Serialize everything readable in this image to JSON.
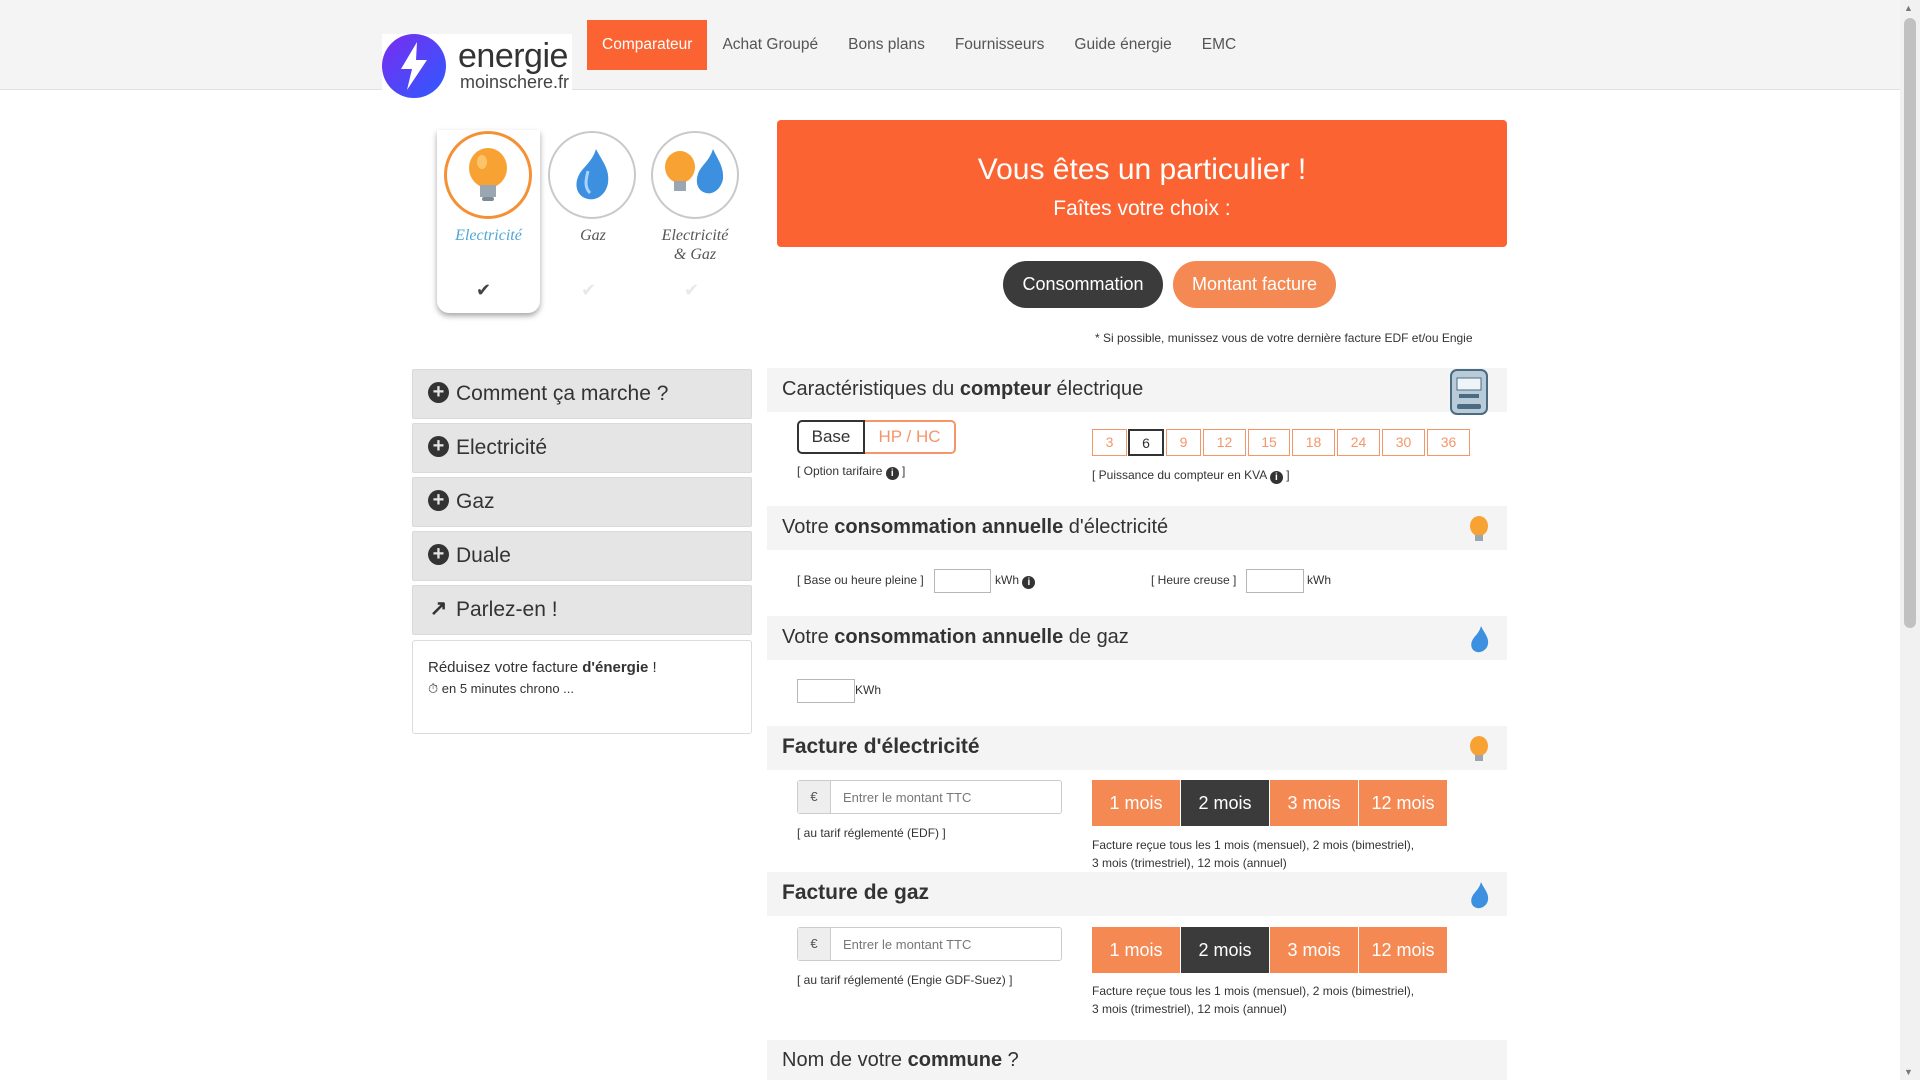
{
  "header": {
    "logo_main": "energie",
    "logo_sub": "moinschere.fr",
    "nav": [
      "Comparateur",
      "Achat Groupé",
      "Bons plans",
      "Fournisseurs",
      "Guide énergie",
      "EMC"
    ]
  },
  "energy_types": [
    {
      "label": "Electricité",
      "selected": true
    },
    {
      "label": "Gaz",
      "selected": false
    },
    {
      "label": "Electricité & Gaz",
      "selected": false
    }
  ],
  "banner": {
    "title": "Vous êtes un particulier !",
    "subtitle": "Faîtes votre choix :"
  },
  "choice": {
    "consommation": "Consommation",
    "montant": "Montant facture"
  },
  "note": "* Si possible, munissez vous de votre dernière facture EDF et/ou Engie",
  "accordion": [
    {
      "label": "Comment ça marche ?"
    },
    {
      "label": "Electricité"
    },
    {
      "label": "Gaz"
    },
    {
      "label": "Duale"
    },
    {
      "label": "Parlez-en !"
    }
  ],
  "promo": {
    "line1_a": "Réduisez votre facture ",
    "line1_b": "d'énergie",
    "line1_c": " !",
    "line2": "en 5 minutes chrono ..."
  },
  "compteur": {
    "title_a": "Caractéristiques du ",
    "title_b": "compteur",
    "title_c": " électrique",
    "option_base": "Base",
    "option_hphc": "HP / HC",
    "option_label": "[ Option tarifaire",
    "kva_values": [
      "3",
      "6",
      "9",
      "12",
      "15",
      "18",
      "24",
      "30",
      "36"
    ],
    "kva_selected": "6",
    "kva_label": "[ Puissance du compteur en KVA"
  },
  "conso_elec": {
    "title_a": "Votre ",
    "title_b": "consommation annuelle",
    "title_c": " d'électricité",
    "base_label": "[ Base ou heure pleine ]",
    "unit": "kWh",
    "creuse_label": "[ Heure creuse ]",
    "unit2": "kWh"
  },
  "conso_gaz": {
    "title_a": "Votre ",
    "title_b": "consommation annuelle",
    "title_c": " de gaz",
    "unit": "KWh"
  },
  "facture_elec": {
    "title": "Facture d'électricité",
    "currency": "€",
    "placeholder": "Entrer le montant TTC",
    "tarif": "[ au tarif réglementé (EDF) ]",
    "periods": [
      "1 mois",
      "2 mois",
      "3 mois",
      "12 mois"
    ],
    "selected_period": "2 mois",
    "desc1": "Facture reçue tous les 1 mois (mensuel), 2 mois (bimestriel),",
    "desc2": "3 mois (trimestriel), 12 mois (annuel)"
  },
  "facture_gaz": {
    "title": "Facture de gaz",
    "currency": "€",
    "placeholder": "Entrer le montant TTC",
    "tarif": "[ au tarif réglementé (Engie GDF-Suez) ]",
    "periods": [
      "1 mois",
      "2 mois",
      "3 mois",
      "12 mois"
    ],
    "selected_period": "2 mois",
    "desc1": "Facture reçue tous les 1 mois (mensuel), 2 mois (bimestriel),",
    "desc2": "3 mois (trimestriel), 12 mois (annuel)"
  },
  "commune": {
    "title_a": "Nom de votre ",
    "title_b": "commune",
    "title_c": " ?"
  },
  "colors": {
    "accent": "#fb6432",
    "light_orange": "#f48953",
    "dark": "#3b3b3b"
  }
}
